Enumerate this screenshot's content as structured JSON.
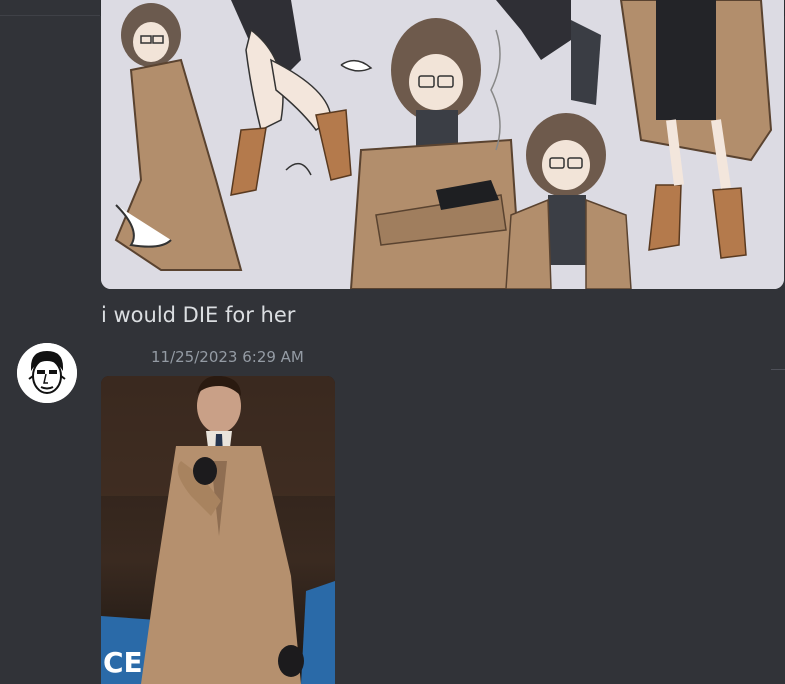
{
  "message_1": {
    "attachment_alt": "Anime character sheet: girl with glasses in a beige trench coat, multiple poses",
    "text": "i would DIE for her"
  },
  "message_2": {
    "timestamp": "11/25/2023 6:29 AM",
    "avatar_icon": "user-avatar-face",
    "attachment_alt": "Man in a camel coat pointing toward the camera",
    "attachment_visible_text": "CE"
  },
  "colors": {
    "background": "#313338",
    "text": "#dbdee1",
    "muted": "#949ba4",
    "coat": "#b28e6c"
  }
}
